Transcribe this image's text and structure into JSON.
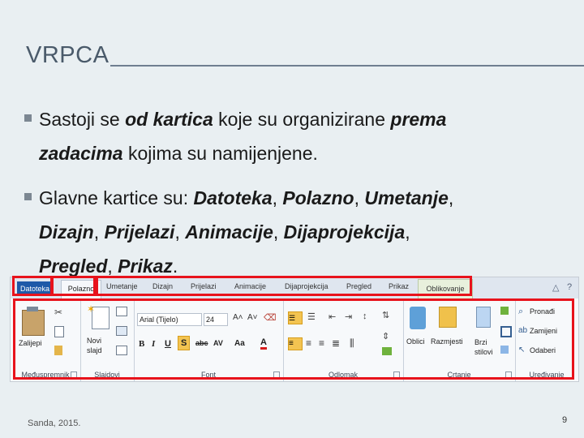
{
  "slide": {
    "title": "VRPCA",
    "bullet1": {
      "t1": "Sastoji se ",
      "b1": "od kartica",
      "t2": " koje su organizirane  ",
      "b2": "prema",
      "b3": "zadacima",
      "t3": " kojima su namijenjene."
    },
    "bullet2": {
      "t1": "Glavne kartice su: ",
      "b1": "Datoteka",
      "c1": ", ",
      "b2": "Polazno",
      "c2": ", ",
      "b3": "Umetanje",
      "c3": ",",
      "b4": "Dizajn",
      "c4": ", ",
      "b5": "Prijelazi",
      "c5": ", ",
      "b6": "Animacije",
      "c6": ", ",
      "b7": "Dijaprojekcija",
      "c7": ",",
      "b8": "Pregled",
      "c8": ", ",
      "b9": "Prikaz",
      "c9": "."
    },
    "footer": "Sanda, 2015.",
    "page_number": "9"
  },
  "ribbon": {
    "tabs": [
      "Datoteka",
      "Polazno",
      "Umetanje",
      "Dizajn",
      "Prijelazi",
      "Animacije",
      "Dijaprojekcija",
      "Pregled",
      "Prikaz",
      "Oblikovanje"
    ],
    "window_icons": [
      "△",
      "?"
    ],
    "groups": {
      "clipboard": {
        "label": "Međuspremnik",
        "paste": "Zalijepi"
      },
      "slides": {
        "label": "Slajdovi",
        "new_slide": "Novi slajd"
      },
      "font": {
        "label": "Font",
        "font_name": "Arial (Tijelo)",
        "font_size": "24",
        "bold": "B",
        "italic": "I",
        "underline": "U",
        "shadow": "S",
        "strike": "abc",
        "spacing": "AV",
        "case": "Aa",
        "color": "A"
      },
      "paragraph": {
        "label": "Odlomak"
      },
      "drawing": {
        "label": "Crtanje",
        "shapes": "Oblici",
        "arrange": "Razmjesti",
        "quick_styles": "Brzi stilovi"
      },
      "editing": {
        "label": "Uređivanje",
        "find": "Pronađi",
        "replace": "Zamijeni",
        "select": "Odaberi"
      }
    }
  }
}
